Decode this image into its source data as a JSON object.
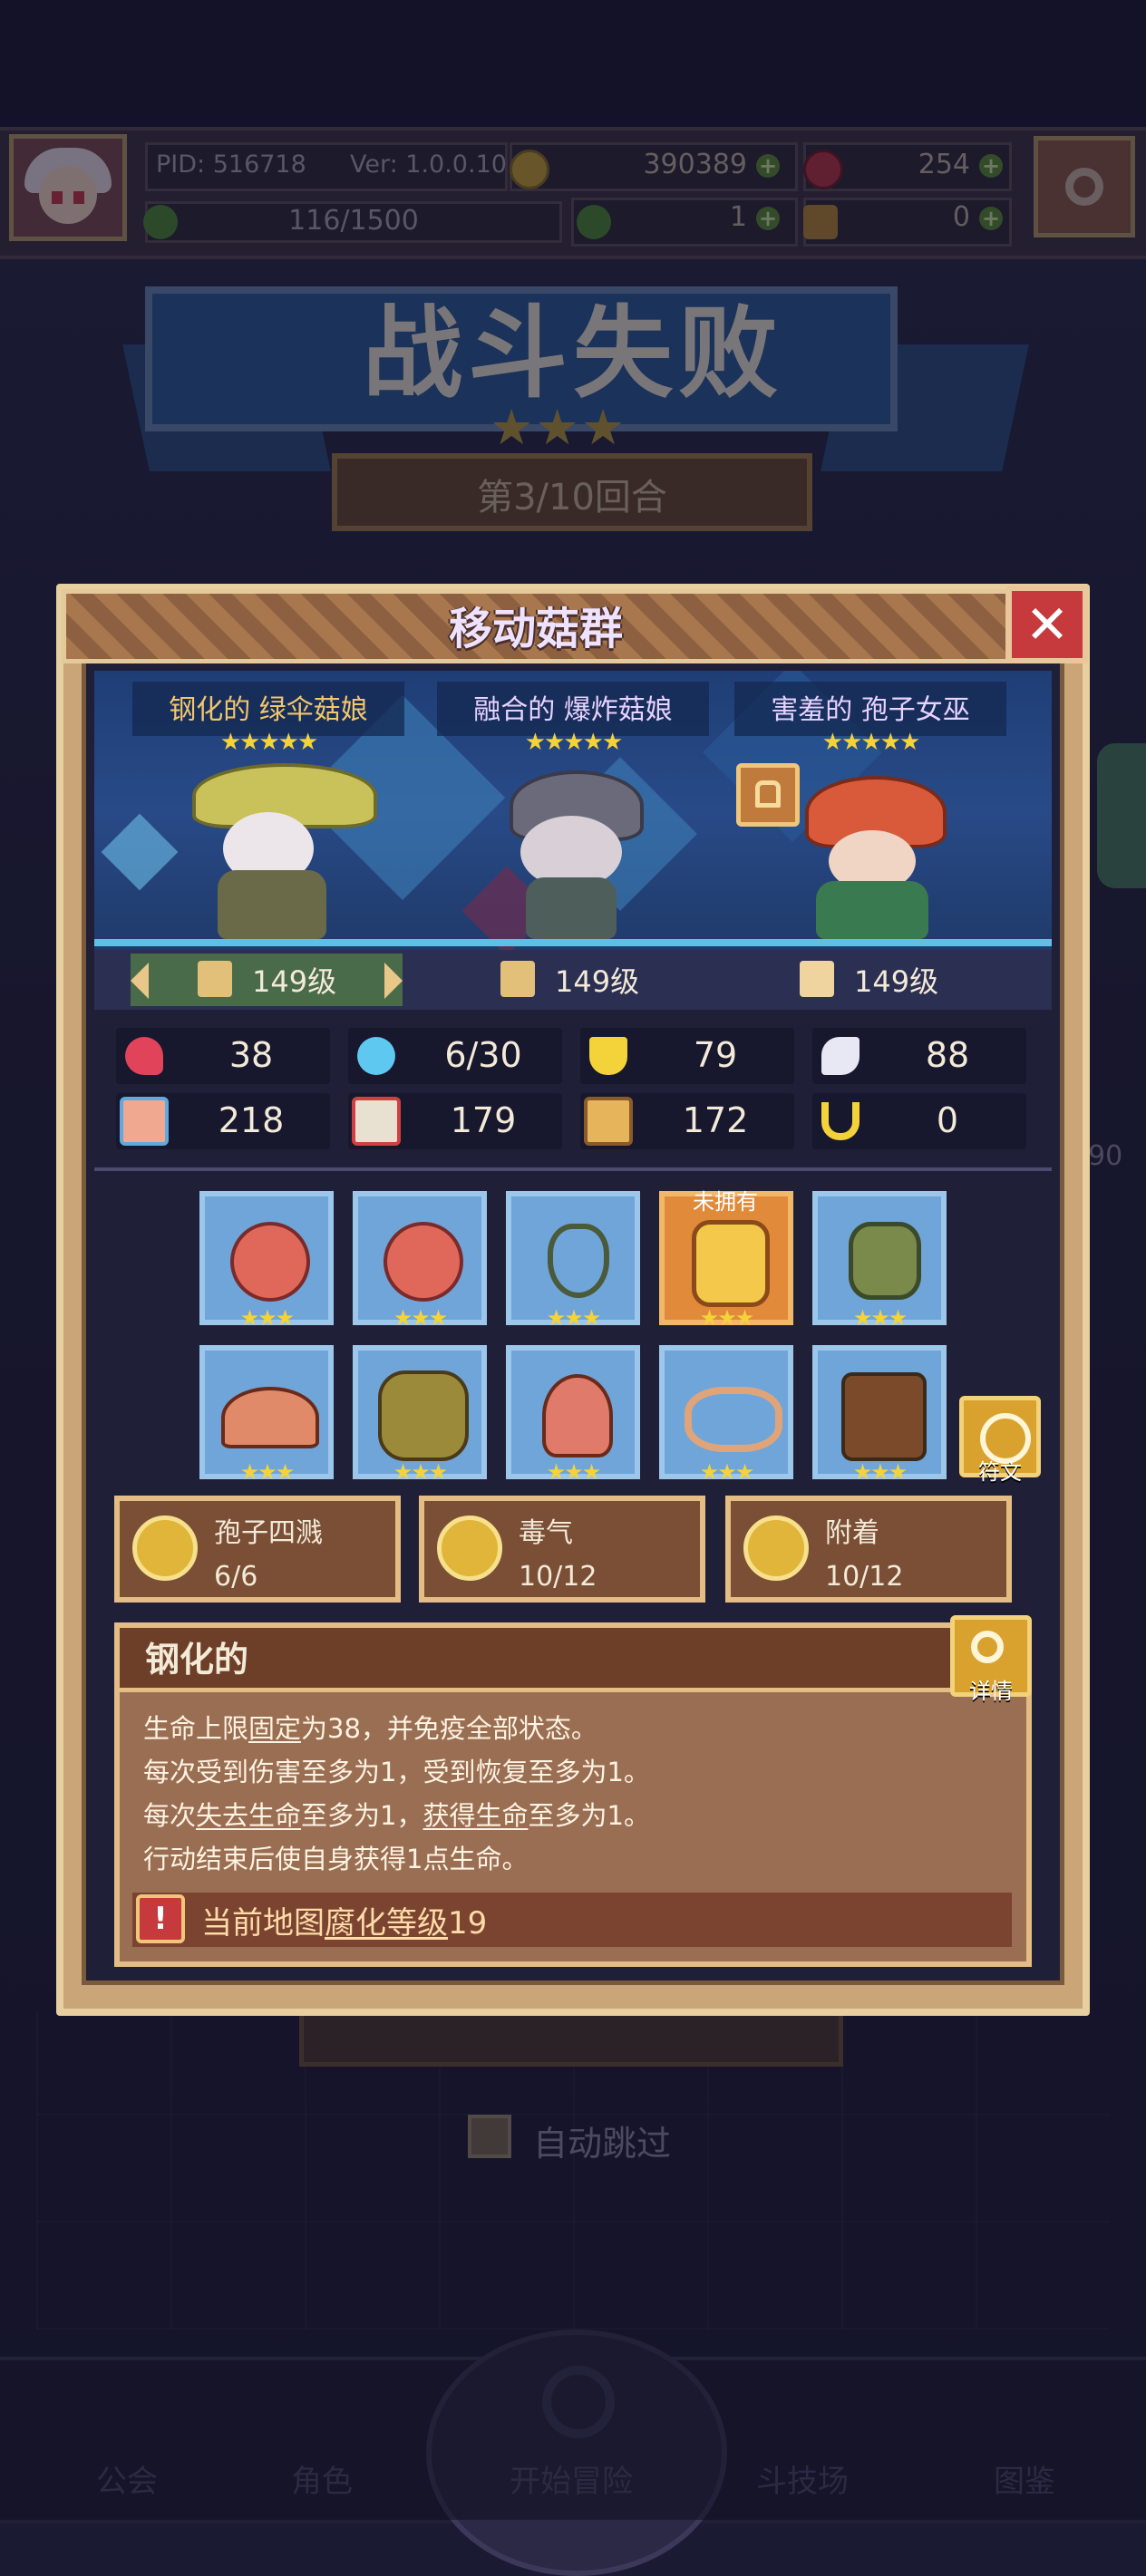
{
  "topbar": {
    "pid": "PID: 516718",
    "version": "Ver: 1.0.0.10",
    "gold": "390389",
    "gems": "254",
    "exp": "116/1500",
    "clover": "1",
    "key": "0"
  },
  "result": {
    "title": "战斗失败",
    "stars": "★★★",
    "round": "第3/10回合"
  },
  "background": {
    "side_number": "90",
    "auto_skip": "自动跳过",
    "nav": [
      "公会",
      "角色",
      "开始冒险",
      "斗技场",
      "图鉴"
    ]
  },
  "dialog": {
    "title": "移动菇群",
    "close": "✕",
    "characters": [
      {
        "name": "钢化的 绿伞菇娘",
        "stars": "★★★★★",
        "name_color": "#f2c66c"
      },
      {
        "name": "融合的 爆炸菇娘",
        "stars": "★★★★★",
        "name_color": "#e8d2ff"
      },
      {
        "name": "害羞的 孢子女巫",
        "stars": "★★★★★",
        "name_color": "#e8d2ff"
      }
    ],
    "levels": [
      "149级",
      "149级",
      "149级"
    ],
    "stats": [
      {
        "icon": "heart-icon",
        "value": "38",
        "color": "#e0435a"
      },
      {
        "icon": "water-drop-icon",
        "value": "6/30",
        "color": "#5fc8f0"
      },
      {
        "icon": "shield-icon",
        "value": "79",
        "color": "#f4d23a"
      },
      {
        "icon": "wing-icon",
        "value": "88",
        "color": "#e8e8f4"
      },
      {
        "icon": "fist-icon",
        "value": "218",
        "color": "#f0a890"
      },
      {
        "icon": "spellbook-icon",
        "value": "179",
        "color": "#e8e0d0"
      },
      {
        "icon": "scroll-icon",
        "value": "172",
        "color": "#e6b45a"
      },
      {
        "icon": "horseshoe-icon",
        "value": "0",
        "color": "#f4d23a"
      }
    ],
    "equipment_stars": "★★★",
    "not_owned_label": "未拥有",
    "rune_label": "符文",
    "skills": [
      {
        "name": "孢子四溅",
        "level": "6/6"
      },
      {
        "name": "毒气",
        "level": "10/12"
      },
      {
        "name": "附着",
        "level": "10/12"
      }
    ],
    "trait": {
      "title": "钢化的",
      "detail_label": "详情",
      "line1_a": "生命上限",
      "line1_u": "固定",
      "line1_b": "为38，并免疫全部状态。",
      "line2": "每次受到伤害至多为1，受到恢复至多为1。",
      "line3_a": "每次",
      "line3_u1": "失去生命",
      "line3_b": "至多为1，",
      "line3_u2": "获得生命",
      "line3_c": "至多为1。",
      "line4": "行动结束后使自身获得1点生命。",
      "warning_a": "当前地图",
      "warning_u": "腐化等级",
      "warning_b": "19",
      "warning_icon": "!"
    }
  }
}
